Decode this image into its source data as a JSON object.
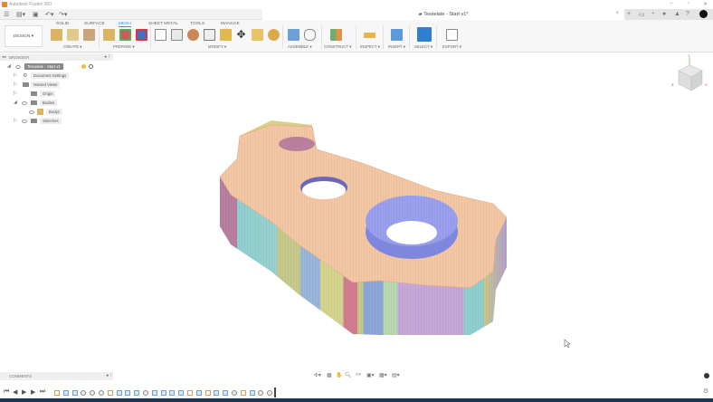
{
  "app": {
    "title": "Autodesk Fusion 360",
    "document_tab": "Tesselate - Start v1*"
  },
  "ribbon": {
    "workspace": "DESIGN ▾",
    "tabs": [
      "SOLID",
      "SURFACE",
      "MESH",
      "SHEET METAL",
      "TOOLS",
      "MANAGE"
    ],
    "active_tab": "MESH",
    "groups": [
      "CREATE ▾",
      "PREPARE ▾",
      "MODIFY ▾",
      "ASSEMBLE ▾",
      "CONSTRUCT ▾",
      "INSPECT ▾",
      "INSERT ▾",
      "SELECT ▾",
      "EXPORT ▾"
    ]
  },
  "browser": {
    "title": "BROWSER",
    "root": "Tesselate - Start v1",
    "items": [
      {
        "label": "Document Settings"
      },
      {
        "label": "Named Views"
      },
      {
        "label": "Origin"
      },
      {
        "label": "Bodies"
      },
      {
        "label": "Body1"
      },
      {
        "label": "Sketches"
      }
    ]
  },
  "comments": {
    "title": "COMMENTS"
  },
  "viewcube": {
    "axes": [
      "Y",
      "Z",
      "X"
    ]
  },
  "timeline": {
    "features": [
      "sketch",
      "mesh",
      "mesh",
      "body",
      "body",
      "body",
      "sketch",
      "mesh",
      "mesh",
      "mesh",
      "body",
      "mesh",
      "mesh",
      "mesh",
      "mesh",
      "sketch",
      "mesh",
      "sketch",
      "mesh",
      "mesh",
      "body",
      "sketch",
      "mesh",
      "body",
      "body"
    ]
  },
  "colors": {
    "accent": "#3d8fd6",
    "top_face": "#f3c7a4",
    "ring": "#8f95e8",
    "bottom_bar": "#1f3550"
  }
}
